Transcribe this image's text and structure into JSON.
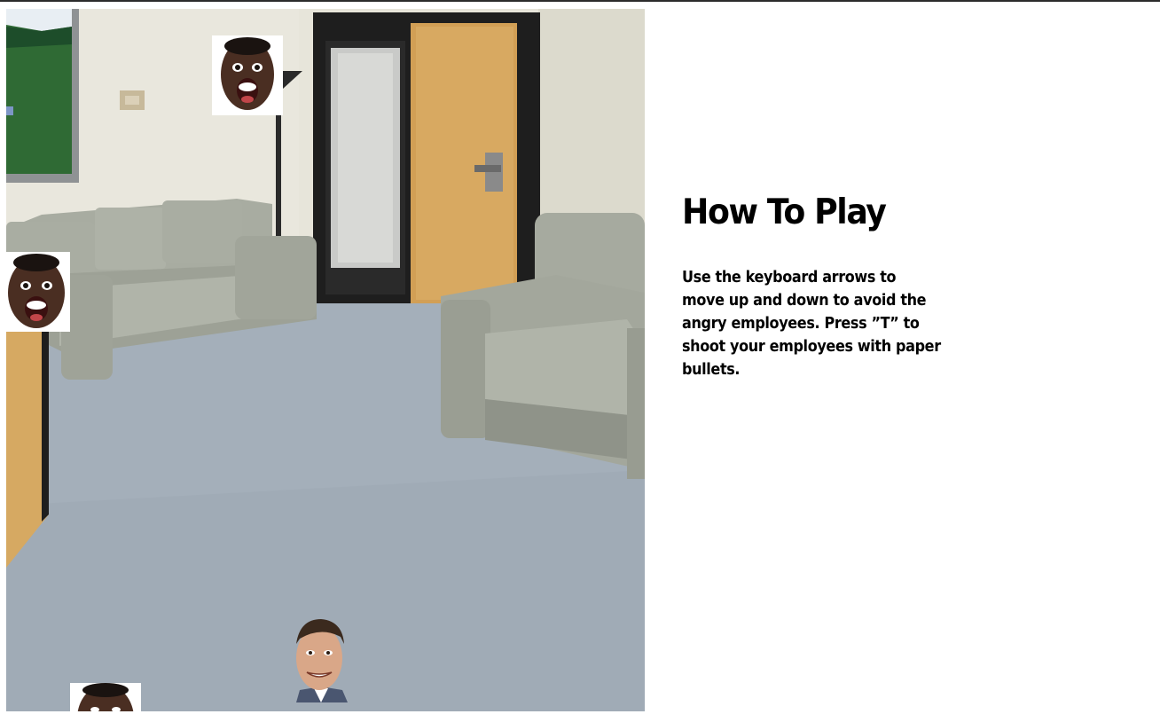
{
  "instructions": {
    "title": "How To Play",
    "body": "Use the keyboard arrows to move up and down to avoid the angry employees. Press ”T” to shoot your employees with paper bullets."
  },
  "game": {
    "background": "office-lobby-scene",
    "player": "player-face-sprite",
    "enemies": [
      "enemy-face-sprite",
      "enemy-face-sprite",
      "enemy-face-sprite"
    ]
  },
  "colors": {
    "wall": "#e6e4d8",
    "carpet": "#a2adb8",
    "sofa": "#a7aba0",
    "door_wood": "#d3a35a",
    "door_frame": "#1c1c1c",
    "skin": "#4a2e22"
  }
}
